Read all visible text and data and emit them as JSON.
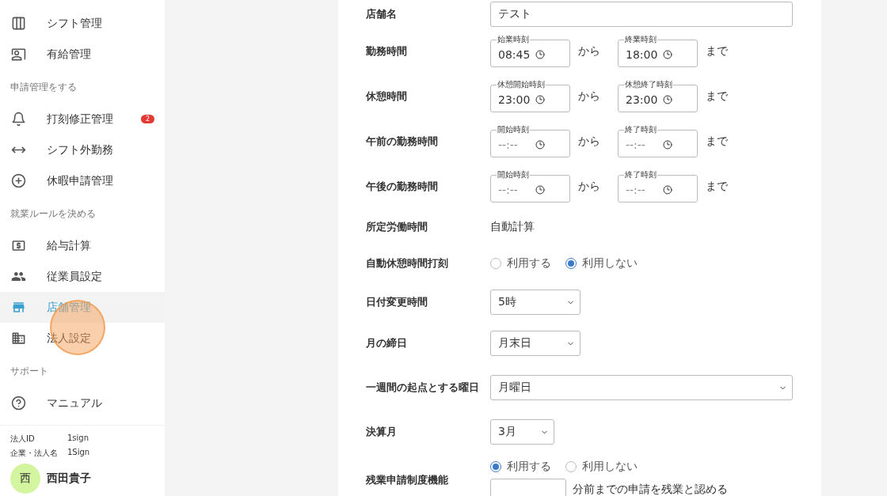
{
  "sidebar": {
    "sections": [
      {
        "items": [
          {
            "label": "シフト管理",
            "selected": false
          },
          {
            "label": "有給管理",
            "selected": false
          }
        ]
      },
      {
        "heading": "申請管理をする",
        "items": [
          {
            "label": "打刻修正管理",
            "selected": false,
            "badge": "2"
          },
          {
            "label": "シフト外勤務",
            "selected": false
          },
          {
            "label": "休暇申請管理",
            "selected": false
          }
        ]
      },
      {
        "heading": "就業ルールを決める",
        "items": [
          {
            "label": "給与計算",
            "selected": false
          },
          {
            "label": "従業員設定",
            "selected": false
          },
          {
            "label": "店舗管理",
            "selected": true
          },
          {
            "label": "法人設定",
            "selected": false
          }
        ]
      },
      {
        "heading": "サポート",
        "items": [
          {
            "label": "マニュアル",
            "selected": false
          }
        ]
      }
    ],
    "footer": {
      "info": [
        {
          "label": "法人ID",
          "value": "1sign"
        },
        {
          "label": "企業・法人名",
          "value": "1Sign"
        }
      ],
      "avatar": "西",
      "user": "西田貴子"
    }
  },
  "form": {
    "rows": [
      {
        "kind": "text",
        "label": "店舗名",
        "value": "テスト"
      },
      {
        "kind": "time_range",
        "label": "勤務時間",
        "from": {
          "legend": "始業時刻",
          "value": "08:45"
        },
        "from_text": "から",
        "to": {
          "legend": "終業時刻",
          "value": "18:00"
        },
        "to_text": "まで"
      },
      {
        "kind": "time_range",
        "label": "休憩時間",
        "from": {
          "legend": "休憩開始時刻",
          "value": "23:00"
        },
        "from_text": "から",
        "to": {
          "legend": "休憩終了時刻",
          "value": "23:00"
        },
        "to_text": "まで"
      },
      {
        "kind": "time_range",
        "label": "午前の勤務時間",
        "from": {
          "legend": "開始時刻",
          "placeholder": "--:--"
        },
        "from_text": "から",
        "to": {
          "legend": "終了時刻",
          "placeholder": "--:--"
        },
        "to_text": "まで"
      },
      {
        "kind": "time_range",
        "label": "午後の勤務時間",
        "from": {
          "legend": "開始時刻",
          "placeholder": "--:--"
        },
        "from_text": "から",
        "to": {
          "legend": "終了時刻",
          "placeholder": "--:--"
        },
        "to_text": "まで"
      },
      {
        "kind": "static",
        "label": "所定労働時間",
        "value": "自動計算"
      },
      {
        "kind": "radio",
        "label": "自動休憩時間打刻",
        "options": [
          {
            "label": "利用する",
            "selected": false
          },
          {
            "label": "利用しない",
            "selected": true
          }
        ]
      },
      {
        "kind": "select",
        "label": "日付変更時間",
        "value": "5時"
      },
      {
        "kind": "select",
        "label": "月の締日",
        "value": "月末日"
      },
      {
        "kind": "select",
        "label": "一週間の起点とする曜日",
        "value": "月曜日"
      },
      {
        "kind": "select",
        "label": "決算月",
        "value": "3月"
      },
      {
        "kind": "overtime",
        "label": "残業申請制度機能",
        "options": [
          {
            "label": "利用する",
            "selected": true
          },
          {
            "label": "利用しない",
            "selected": false
          }
        ],
        "suffix": "分前までの申請を残業と認める"
      }
    ]
  }
}
